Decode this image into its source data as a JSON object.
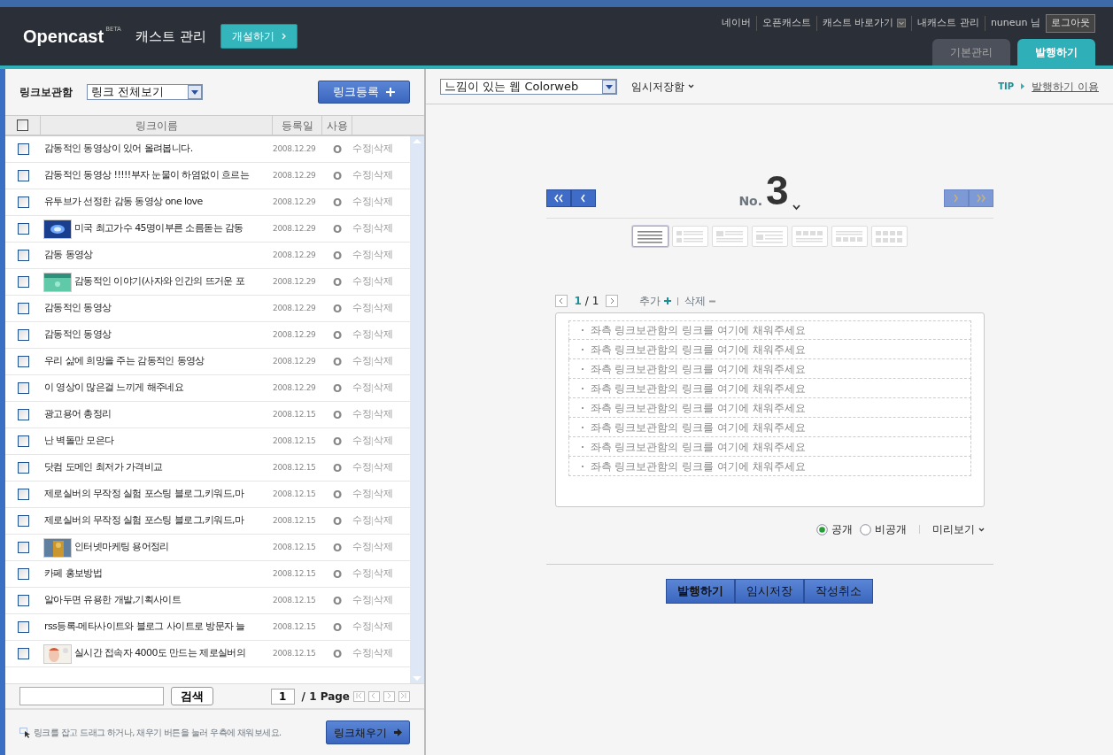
{
  "header": {
    "logo": "Opencast",
    "logo_badge": "BETA",
    "title": "캐스트 관리",
    "open_button": "개설하기",
    "top_links": [
      "네이버",
      "오픈캐스트",
      "캐스트 바로가기",
      "내캐스트 관리"
    ],
    "user": "nuneun 님",
    "logout": "로그아웃",
    "tabs": [
      {
        "label": "기본관리",
        "selected": false
      },
      {
        "label": "발행하기",
        "selected": true
      }
    ]
  },
  "link_box": {
    "title": "링크보관함",
    "filter": "링크 전체보기",
    "register_button": "링크등록",
    "select_all_checked": false,
    "columns": [
      "링크이름",
      "등록일",
      "사용"
    ],
    "rows": [
      {
        "name": "감동적인 동영상이 있어 올려봅니다.",
        "date": "2008.12.29",
        "used": "O",
        "edit": "수정",
        "delete": "삭제",
        "thumbnail": false,
        "checked": false
      },
      {
        "name": "감동적인 동영상 !!!!!부자 눈물이 하염없이 흐르는",
        "date": "2008.12.29",
        "used": "O",
        "edit": "수정",
        "delete": "삭제",
        "thumbnail": false,
        "checked": false
      },
      {
        "name": "유투브가 선정한 감동 동영상 one love",
        "date": "2008.12.29",
        "used": "O",
        "edit": "수정",
        "delete": "삭제",
        "thumbnail": false,
        "checked": false
      },
      {
        "name": "미국 최고가수 45명이부른 소름돋는 감동",
        "date": "2008.12.29",
        "used": "O",
        "edit": "수정",
        "delete": "삭제",
        "thumbnail": true,
        "checked": false
      },
      {
        "name": "감동 동영상",
        "date": "2008.12.29",
        "used": "O",
        "edit": "수정",
        "delete": "삭제",
        "thumbnail": false,
        "checked": false
      },
      {
        "name": "감동적인 이야기(사자와 인간의 뜨거운 포",
        "date": "2008.12.29",
        "used": "O",
        "edit": "수정",
        "delete": "삭제",
        "thumbnail": true,
        "checked": false
      },
      {
        "name": "감동적인 동영상",
        "date": "2008.12.29",
        "used": "O",
        "edit": "수정",
        "delete": "삭제",
        "thumbnail": false,
        "checked": false
      },
      {
        "name": "감동적인 동영상",
        "date": "2008.12.29",
        "used": "O",
        "edit": "수정",
        "delete": "삭제",
        "thumbnail": false,
        "checked": false
      },
      {
        "name": "우리 삶에 희망을 주는 감동적인 동영상",
        "date": "2008.12.29",
        "used": "O",
        "edit": "수정",
        "delete": "삭제",
        "thumbnail": false,
        "checked": false
      },
      {
        "name": "이 영상이 많은걸 느끼게 해주네요",
        "date": "2008.12.29",
        "used": "O",
        "edit": "수정",
        "delete": "삭제",
        "thumbnail": false,
        "checked": false
      },
      {
        "name": "광고용어 총정리",
        "date": "2008.12.15",
        "used": "O",
        "edit": "수정",
        "delete": "삭제",
        "thumbnail": false,
        "checked": false
      },
      {
        "name": "난 벽돌만 모은다",
        "date": "2008.12.15",
        "used": "O",
        "edit": "수정",
        "delete": "삭제",
        "thumbnail": false,
        "checked": false
      },
      {
        "name": "닷컴 도메인 최저가 가격비교",
        "date": "2008.12.15",
        "used": "O",
        "edit": "수정",
        "delete": "삭제",
        "thumbnail": false,
        "checked": false
      },
      {
        "name": "제로실버의 무작정 실험 포스팅 블로그,키워드,마",
        "date": "2008.12.15",
        "used": "O",
        "edit": "수정",
        "delete": "삭제",
        "thumbnail": false,
        "checked": false
      },
      {
        "name": "제로실버의 무작정 실험 포스팅 블로그,키워드,마",
        "date": "2008.12.15",
        "used": "O",
        "edit": "수정",
        "delete": "삭제",
        "thumbnail": false,
        "checked": false
      },
      {
        "name": "인터넷마케팅 용어정리",
        "date": "2008.12.15",
        "used": "O",
        "edit": "수정",
        "delete": "삭제",
        "thumbnail": true,
        "checked": false
      },
      {
        "name": "카페 홍보방법",
        "date": "2008.12.15",
        "used": "O",
        "edit": "수정",
        "delete": "삭제",
        "thumbnail": false,
        "checked": false
      },
      {
        "name": "알아두면 유용한 개발,기획사이트",
        "date": "2008.12.15",
        "used": "O",
        "edit": "수정",
        "delete": "삭제",
        "thumbnail": false,
        "checked": false
      },
      {
        "name": "rss등록-메타사이트와 블로그 사이트로 방문자 늘",
        "date": "2008.12.15",
        "used": "O",
        "edit": "수정",
        "delete": "삭제",
        "thumbnail": false,
        "checked": false
      },
      {
        "name": "실시간 접속자 4000도 만드는 제로실버의",
        "date": "2008.12.15",
        "used": "O",
        "edit": "수정",
        "delete": "삭제",
        "thumbnail": true,
        "checked": false
      }
    ],
    "search_button": "검색",
    "page_input": "1",
    "page_total": "/ 1 Page",
    "hint": "링크를 잡고 드래그 하거나, 채우기 버튼을 눌러 우측에 채워보세요.",
    "fill_button": "링크채우기"
  },
  "publish": {
    "theme": "느낌이 있는 웹 Colorweb",
    "temp_box": "임시저장함",
    "tip_label": "TIP",
    "tip_link": "발행하기 이용",
    "number_prefix": "No.",
    "number": "3",
    "layouts": [
      {
        "selected": true
      },
      {
        "selected": false
      },
      {
        "selected": false
      },
      {
        "selected": false
      },
      {
        "selected": false
      },
      {
        "selected": false
      },
      {
        "selected": false
      }
    ],
    "slot_page": "1",
    "slot_total": "/ 1",
    "add": "추가",
    "remove": "삭제",
    "slots": [
      "좌측 링크보관함의 링크를 여기에 채워주세요",
      "좌측 링크보관함의 링크를 여기에 채워주세요",
      "좌측 링크보관함의 링크를 여기에 채워주세요",
      "좌측 링크보관함의 링크를 여기에 채워주세요",
      "좌측 링크보관함의 링크를 여기에 채워주세요",
      "좌측 링크보관함의 링크를 여기에 채워주세요",
      "좌측 링크보관함의 링크를 여기에 채워주세요",
      "좌측 링크보관함의 링크를 여기에 채워주세요"
    ],
    "visibility": [
      {
        "label": "공개",
        "selected": true
      },
      {
        "label": "비공개",
        "selected": false
      }
    ],
    "preview": "미리보기",
    "buttons": [
      "발행하기",
      "임시저장",
      "작성취소"
    ]
  }
}
